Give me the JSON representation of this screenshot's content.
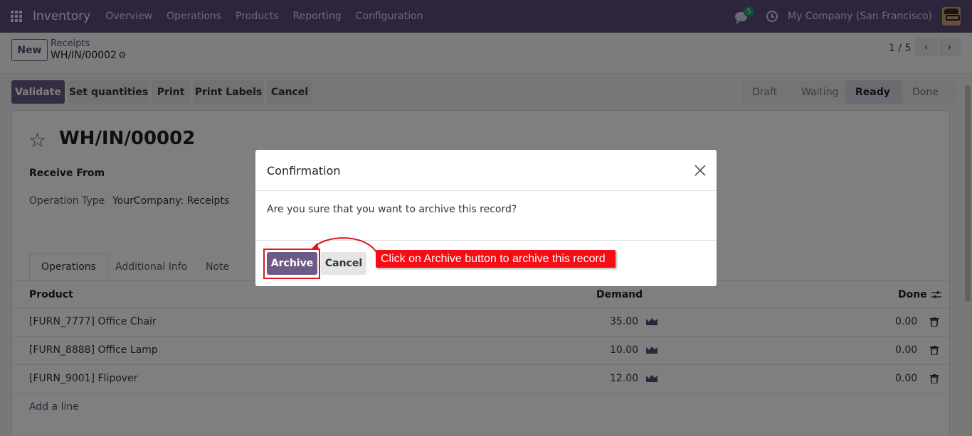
{
  "navbar": {
    "app_name": "Inventory",
    "menu": [
      "Overview",
      "Operations",
      "Products",
      "Reporting",
      "Configuration"
    ],
    "chat_count": "5",
    "company": "My Company (San Francisco)"
  },
  "control_panel": {
    "new_label": "New",
    "breadcrumb_parent": "Receipts",
    "breadcrumb_current": "WH/IN/00002",
    "pager": "1 / 5"
  },
  "actions": {
    "validate": "Validate",
    "set_quantities": "Set quantities",
    "print": "Print",
    "print_labels": "Print Labels",
    "cancel": "Cancel"
  },
  "statusbar": [
    "Draft",
    "Waiting",
    "Ready",
    "Done"
  ],
  "statusbar_active": "Ready",
  "record": {
    "title": "WH/IN/00002",
    "receive_from_label": "Receive From",
    "operation_type_label": "Operation Type",
    "operation_type_value": "YourCompany: Receipts"
  },
  "tabs": [
    "Operations",
    "Additional Info",
    "Note"
  ],
  "table": {
    "headers": {
      "product": "Product",
      "demand": "Demand",
      "done": "Done"
    },
    "rows": [
      {
        "product": "[FURN_7777] Office Chair",
        "demand": "35.00",
        "done": "0.00"
      },
      {
        "product": "[FURN_8888] Office Lamp",
        "demand": "10.00",
        "done": "0.00"
      },
      {
        "product": "[FURN_9001] Flipover",
        "demand": "12.00",
        "done": "0.00"
      }
    ],
    "add_line": "Add a line"
  },
  "modal": {
    "title": "Confirmation",
    "body": "Are you sure that you want to archive this record?",
    "archive_label": "Archive",
    "cancel_label": "Cancel"
  },
  "annotation": {
    "text": "Click on Archive button to archive this record"
  },
  "colors": {
    "navbar": "#5b4a77",
    "primary": "#6b5b86",
    "callout": "#f50c14",
    "badge": "#1e9d6a"
  }
}
